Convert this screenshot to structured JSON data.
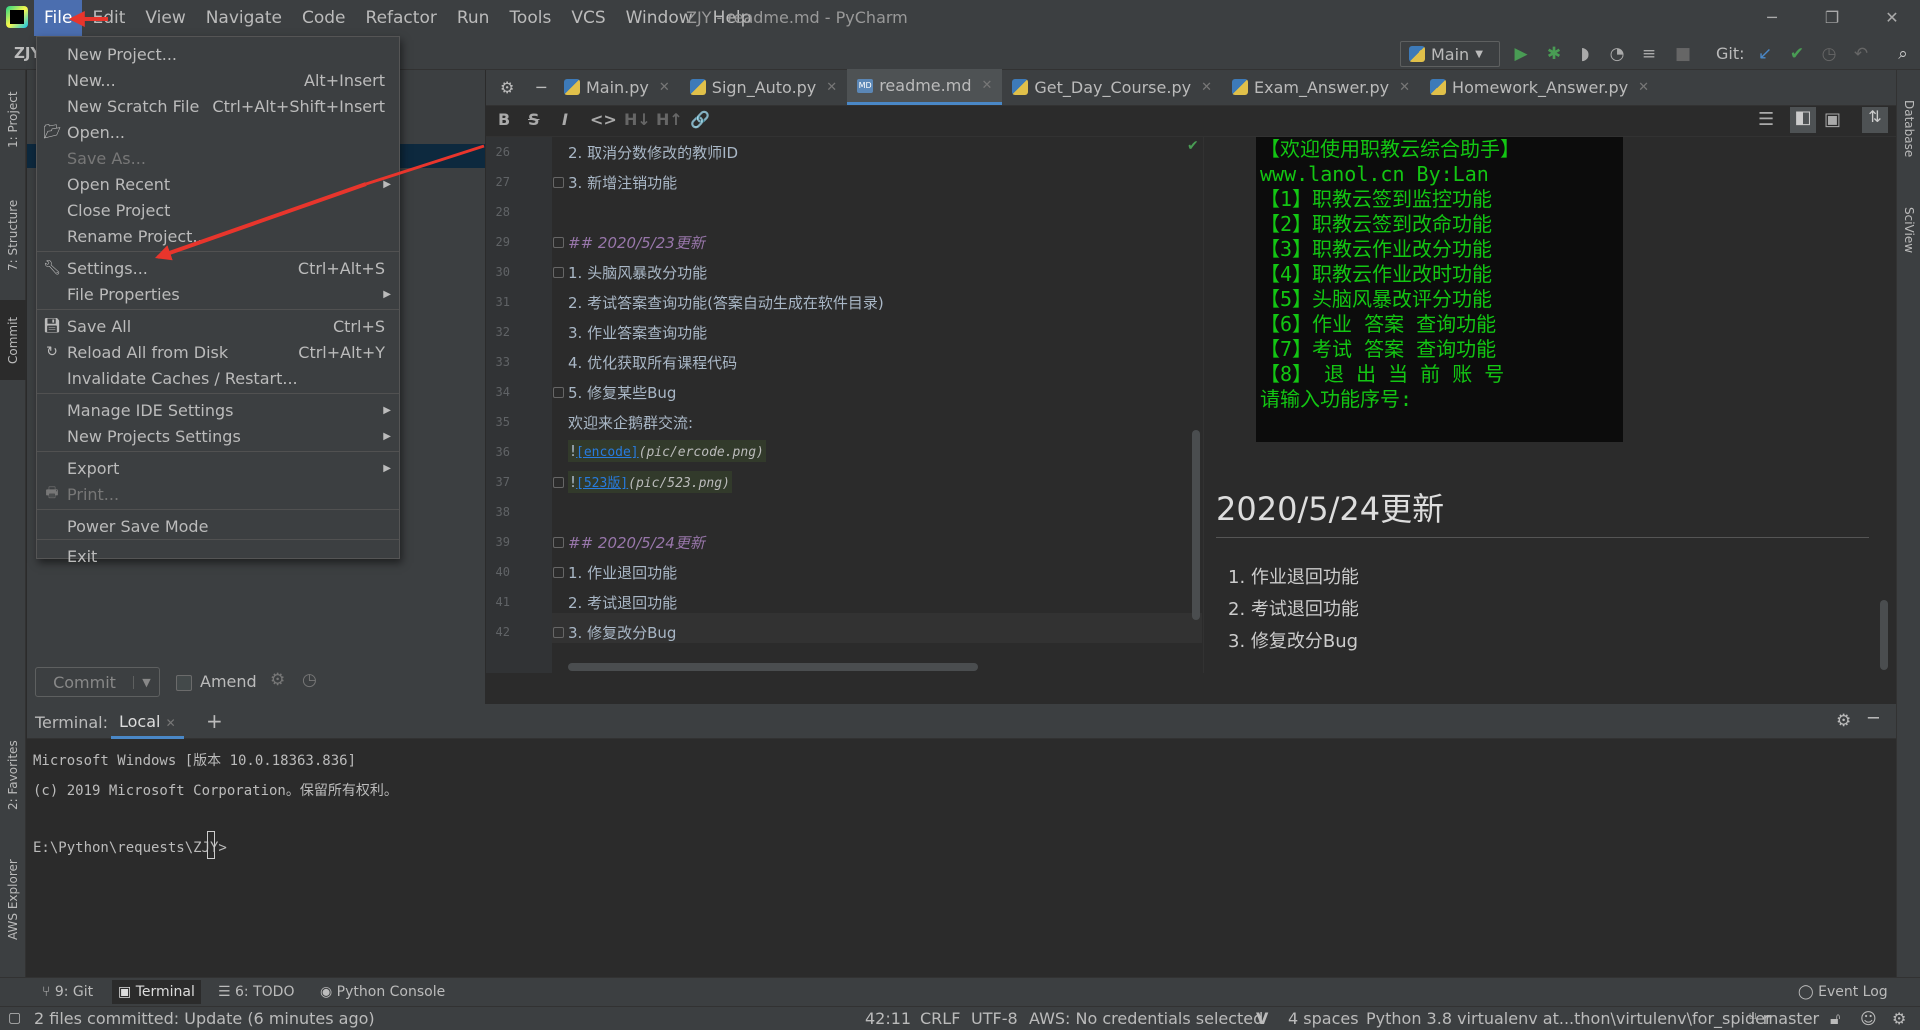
{
  "menubar": [
    "File",
    "Edit",
    "View",
    "Navigate",
    "Code",
    "Refactor",
    "Run",
    "Tools",
    "VCS",
    "Window",
    "Help"
  ],
  "window_title": "ZJY - readme.md - PyCharm",
  "project_crumb": "ZJY",
  "toolbar": {
    "run_config": "Main",
    "git_label": "Git:"
  },
  "left_tabs": [
    "1: Project",
    "7: Structure",
    "Commit",
    "2: Favorites",
    "AWS Explorer"
  ],
  "right_tabs": [
    "Database",
    "SciView"
  ],
  "commit": {
    "button": "Commit",
    "amend": "Amend"
  },
  "tabs": [
    {
      "label": "Main.py"
    },
    {
      "label": "Sign_Auto.py"
    },
    {
      "label": "readme.md"
    },
    {
      "label": "Get_Day_Course.py"
    },
    {
      "label": "Exam_Answer.py"
    },
    {
      "label": "Homework_Answer.py"
    }
  ],
  "md_toolbar": [
    "B",
    "S",
    "I",
    "<>",
    "H↓",
    "H↑",
    "🔗"
  ],
  "editor_lines": [
    {
      "n": "26",
      "t": "2.  取消分数修改的教师ID"
    },
    {
      "n": "27",
      "t": "3.  新增注销功能"
    },
    {
      "n": "28",
      "t": ""
    },
    {
      "n": "29",
      "t": "## 2020/5/23更新"
    },
    {
      "n": "30",
      "t": "1.  头脑风暴改分功能"
    },
    {
      "n": "31",
      "t": "2.  考试答案查询功能(答案自动生成在软件目录)"
    },
    {
      "n": "32",
      "t": "3.  作业答案查询功能"
    },
    {
      "n": "33",
      "t": "4.  优化获取所有课程代码"
    },
    {
      "n": "34",
      "t": "5.  修复某些Bug"
    },
    {
      "n": "35",
      "t": "欢迎来企鹅群交流:"
    },
    {
      "n": "36",
      "t": ""
    },
    {
      "n": "37",
      "t": ""
    },
    {
      "n": "38",
      "t": ""
    },
    {
      "n": "39",
      "t": "## 2020/5/24更新"
    },
    {
      "n": "40",
      "t": "1.  作业退回功能"
    },
    {
      "n": "41",
      "t": "2.  考试退回功能"
    },
    {
      "n": "42",
      "t": "3.  修复改分Bug"
    }
  ],
  "img_links": [
    {
      "bang": "!",
      "text": "[encode]",
      "path": "(pic/ercode.png)"
    },
    {
      "bang": "!",
      "text": "[523版]",
      "path": "(pic/523.png)"
    }
  ],
  "console_lines": [
    "【欢迎使用职教云综合助手】",
    "www.lanol.cn     By:Lan",
    "【1】职教云签到监控功能",
    "【2】职教云签到改命功能",
    "【3】职教云作业改分功能",
    "【4】职教云作业改时功能",
    "【5】头脑风暴改评分功能",
    "【6】作业 答案 查询功能",
    "【7】考试 答案 查询功能",
    "【8】 退 出 当 前 账 号",
    "请输入功能序号:"
  ],
  "preview": {
    "heading": "2020/5/24更新",
    "items": [
      "作业退回功能",
      "考试退回功能",
      "修复改分Bug"
    ],
    "markers": [
      "1.",
      "2.",
      "3."
    ]
  },
  "terminal": {
    "title": "Terminal:",
    "tab": "Local",
    "lines": [
      "Microsoft Windows [版本 10.0.18363.836]",
      "(c) 2019 Microsoft Corporation。保留所有权利。",
      "",
      "E:\\Python\\requests\\ZJY>"
    ]
  },
  "bottom_tabs": [
    "9: Git",
    "Terminal",
    "6: TODO",
    "Python Console",
    "Event Log"
  ],
  "status": {
    "message": "2 files committed: Update (6 minutes ago)",
    "pos": "42:11",
    "eol": "CRLF",
    "enc": "UTF-8",
    "aws": "AWS: No credentials selected",
    "indent": "4 spaces",
    "interp": "Python 3.8 virtualenv at...thon\\virtulenv\\for_spider",
    "branch": "master"
  },
  "file_menu": [
    {
      "label": "New Project...",
      "shortcut": ""
    },
    {
      "label": "New...",
      "shortcut": "Alt+Insert"
    },
    {
      "label": "New Scratch File",
      "shortcut": "Ctrl+Alt+Shift+Insert"
    },
    {
      "label": "Open...",
      "shortcut": ""
    },
    {
      "label": "Save As...",
      "shortcut": ""
    },
    {
      "label": "Open Recent",
      "shortcut": ""
    },
    {
      "label": "Close Project",
      "shortcut": ""
    },
    {
      "label": "Rename Project...",
      "shortcut": ""
    },
    {
      "label": "Settings...",
      "shortcut": "Ctrl+Alt+S"
    },
    {
      "label": "File Properties",
      "shortcut": ""
    },
    {
      "label": "Save All",
      "shortcut": "Ctrl+S"
    },
    {
      "label": "Reload All from Disk",
      "shortcut": "Ctrl+Alt+Y"
    },
    {
      "label": "Invalidate Caches / Restart...",
      "shortcut": ""
    },
    {
      "label": "Manage IDE Settings",
      "shortcut": ""
    },
    {
      "label": "New Projects Settings",
      "shortcut": ""
    },
    {
      "label": "Export",
      "shortcut": ""
    },
    {
      "label": "Print...",
      "shortcut": ""
    },
    {
      "label": "Power Save Mode",
      "shortcut": ""
    },
    {
      "label": "Exit",
      "shortcut": ""
    }
  ],
  "colors": {
    "accent": "#4b6eaf",
    "annotation_arrow": "#e8352c",
    "console_text": "#13c613"
  }
}
